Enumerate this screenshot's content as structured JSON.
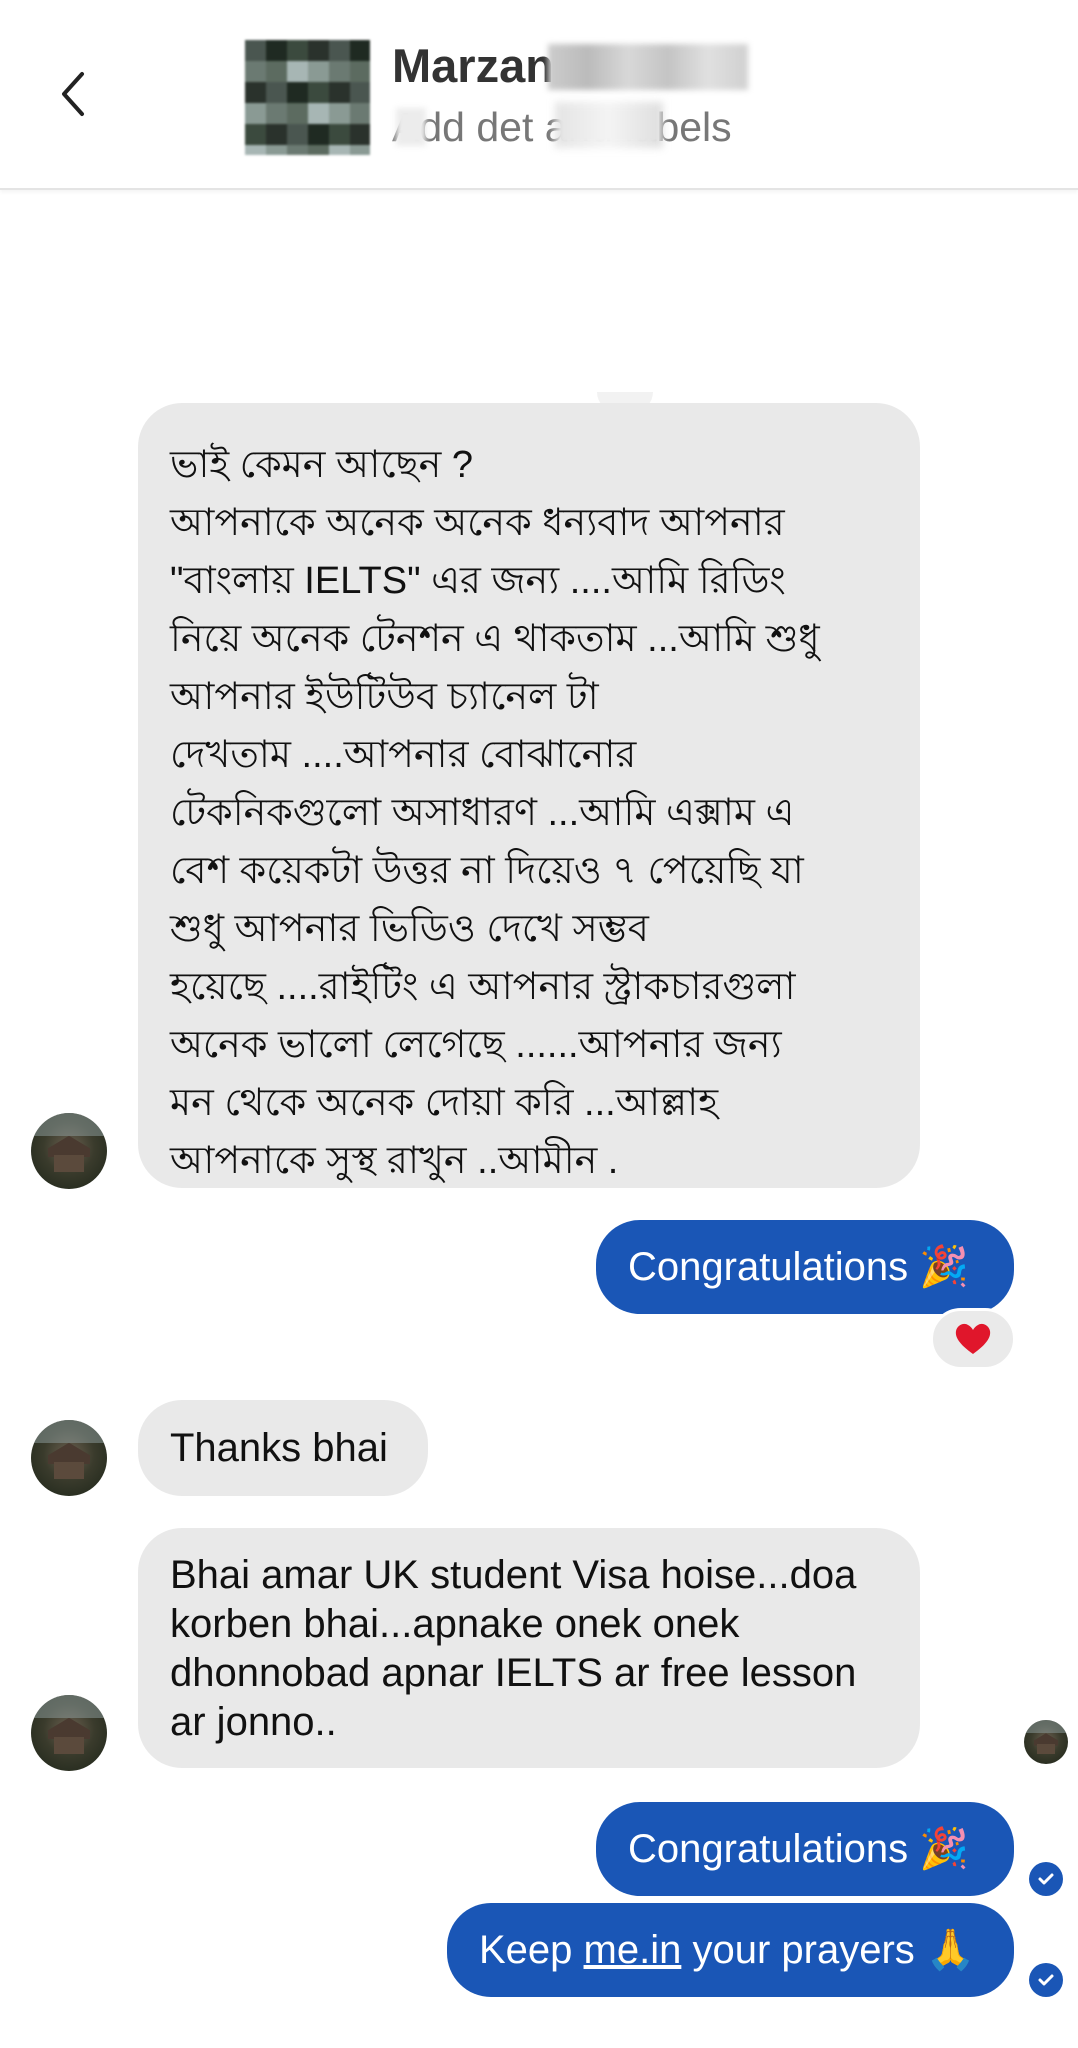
{
  "header": {
    "contact_name": "Marzan",
    "subtitle": "Add det     and labels"
  },
  "messages": [
    {
      "direction": "incoming",
      "lines": [
        "ভাই কেমন আছেন ?",
        "আপনাকে অনেক অনেক ধন্যবাদ আপনার",
        "\"বাংলায় IELTS\"  এর জন্য ....আমি রিডিং",
        "নিয়ে অনেক টেনশন এ থাকতাম ...আমি শুধু",
        "আপনার ইউটিউব চ্যানেল টা",
        "দেখতাম ....আপনার বোঝানোর",
        "টেকনিকগুলো অসাধারণ ...আমি এক্সাম এ",
        "বেশ কয়েকটা উত্তর না দিয়েও ৭ পেয়েছি  যা",
        "শুধু আপনার ভিডিও দেখে সম্ভব",
        "হয়েছে ....রাইটিং এ আপনার স্ট্রাকচারগুলা",
        "অনেক ভালো লেগেছে ......আপনার জন্য",
        "মন থেকে অনেক দোয়া করি ...আল্লাহ",
        "আপনাকে সুস্থ রাখুন ..আমীন ."
      ]
    },
    {
      "direction": "outgoing",
      "text": "Congratulations 🎉",
      "reaction": "heart"
    },
    {
      "direction": "incoming",
      "text": "Thanks bhai"
    },
    {
      "direction": "incoming",
      "lines": [
        "Bhai amar UK student Visa hoise...doa",
        "korben bhai...apnake onek onek",
        "dhonnobad apnar IELTS ar free lesson",
        "ar jonno.."
      ]
    },
    {
      "direction": "outgoing",
      "text": "Congratulations 🎉",
      "status": "sent"
    },
    {
      "direction": "outgoing",
      "text_before": "Keep ",
      "link_text": "me.in",
      "text_after": " your prayers 🙏",
      "status": "sent"
    }
  ],
  "colors": {
    "outgoing_bubble": "#1a56b6",
    "incoming_bubble": "#e9e9e9",
    "reaction_heart": "#e0162b"
  }
}
